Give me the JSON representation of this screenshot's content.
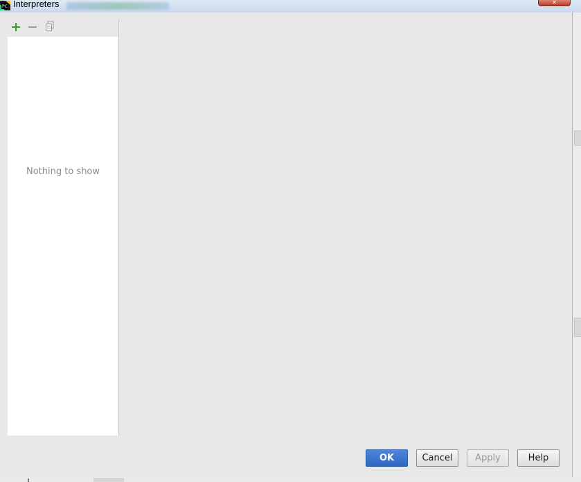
{
  "window": {
    "title": "Interpreters",
    "close_glyph": "✕"
  },
  "toolbar": {
    "items": [
      {
        "name": "add-icon",
        "color": "#2f9e2f"
      },
      {
        "name": "remove-icon",
        "color": "#9c9c9c"
      },
      {
        "name": "copy-icon",
        "color": "#9c9c9c"
      }
    ]
  },
  "list": {
    "empty_text": "Nothing to show"
  },
  "buttons": {
    "ok": "OK",
    "cancel": "Cancel",
    "apply": "Apply",
    "help": "Help"
  },
  "colors": {
    "primary_button": "#3a70cc",
    "background": "#e8e8e8",
    "list_background": "#ffffff"
  }
}
